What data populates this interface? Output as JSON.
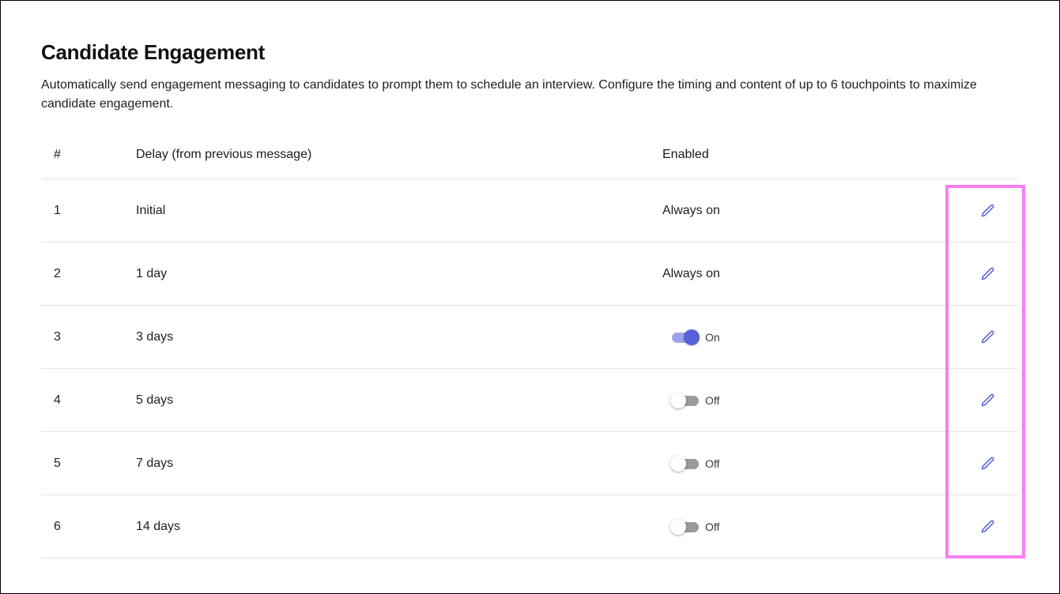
{
  "page": {
    "title": "Candidate Engagement",
    "description": "Automatically send engagement messaging to candidates to prompt them to schedule an interview. Configure the timing and content of up to 6 touchpoints to maximize candidate engagement."
  },
  "table": {
    "headers": {
      "number": "#",
      "delay": "Delay (from previous message)",
      "enabled": "Enabled"
    },
    "rows": [
      {
        "number": "1",
        "delay": "Initial",
        "enabled": "Always on"
      },
      {
        "number": "2",
        "delay": "1 day",
        "enabled": "Always on"
      },
      {
        "number": "3",
        "delay": "3 days",
        "toggle_state": "on",
        "toggle_label": "On"
      },
      {
        "number": "4",
        "delay": "5 days",
        "toggle_state": "off",
        "toggle_label": "Off"
      },
      {
        "number": "5",
        "delay": "7 days",
        "toggle_state": "off",
        "toggle_label": "Off"
      },
      {
        "number": "6",
        "delay": "14 days",
        "toggle_state": "off",
        "toggle_label": "Off"
      }
    ]
  },
  "icons": {
    "edit": "pencil-icon"
  },
  "colors": {
    "accent": "#5660d8",
    "toggle_on_track": "#9ea3e8",
    "toggle_off_track": "#9a9a9a",
    "highlight": "#f77ff0",
    "divider": "#e3e3e3"
  }
}
